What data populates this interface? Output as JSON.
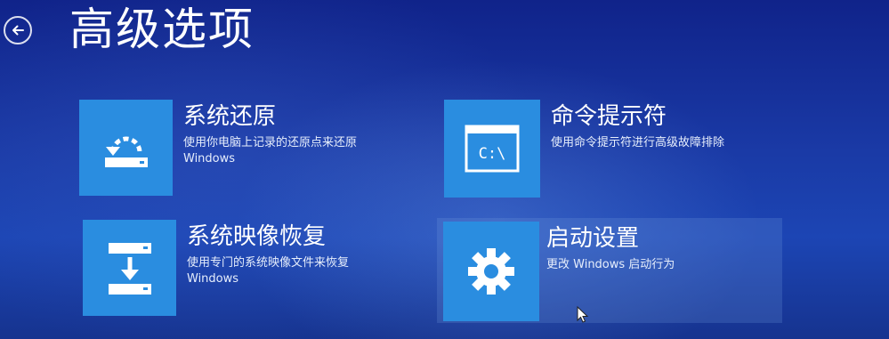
{
  "header": {
    "title": "高级选项",
    "back_icon": "back-arrow-icon"
  },
  "options": [
    {
      "title": "系统还原",
      "desc_lines": [
        "使用你电脑上记录的还原点来还原",
        "Windows"
      ],
      "icon": "system-restore-icon"
    },
    {
      "title": "命令提示符",
      "desc_lines": [
        "使用命令提示符进行高级故障排除"
      ],
      "icon": "command-prompt-icon",
      "icon_text": "C:\\"
    },
    {
      "title": "系统映像恢复",
      "desc_lines": [
        "使用专门的系统映像文件来恢复",
        "Windows"
      ],
      "icon": "system-image-recovery-icon"
    },
    {
      "title": "启动设置",
      "desc_lines": [
        "更改 Windows 启动行为"
      ],
      "icon": "startup-settings-gear-icon",
      "selected": true
    }
  ],
  "colors": {
    "tile": "#2a8de0",
    "background": "#1a3aa6",
    "text": "#ffffff"
  }
}
